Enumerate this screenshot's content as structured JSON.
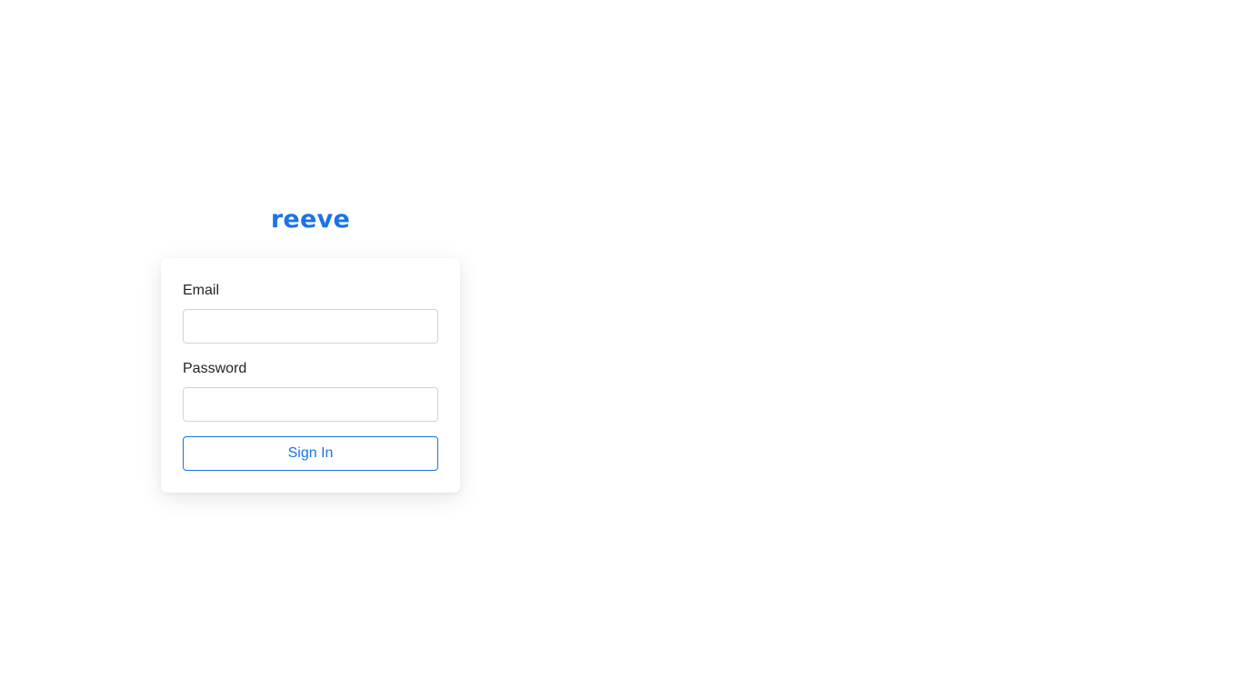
{
  "brand": {
    "name": "reeve",
    "color": "#1a73e8"
  },
  "form": {
    "email": {
      "label": "Email",
      "value": "",
      "placeholder": ""
    },
    "password": {
      "label": "Password",
      "value": "",
      "placeholder": ""
    },
    "submit_label": "Sign In"
  }
}
